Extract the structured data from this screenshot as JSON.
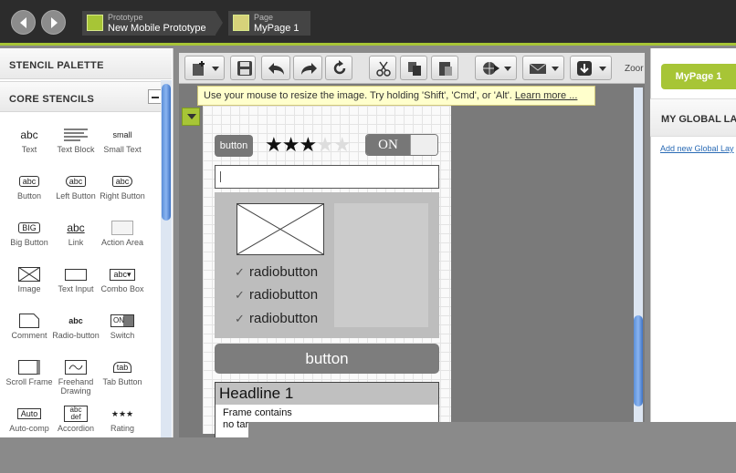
{
  "header": {
    "prototype_small": "Prototype",
    "prototype_name": "New Mobile Prototype",
    "page_small": "Page",
    "page_name": "MyPage 1"
  },
  "left_panel": {
    "title": "STENCIL PALETTE",
    "section": "CORE STENCILS",
    "stencils": [
      {
        "glyph": "abc",
        "label": "Text"
      },
      {
        "glyph": "",
        "label": "Text Block"
      },
      {
        "glyph": "small",
        "label": "Small Text"
      },
      {
        "glyph": "abc",
        "label": "Button"
      },
      {
        "glyph": "abc",
        "label": "Left Button"
      },
      {
        "glyph": "abc",
        "label": "Right Button"
      },
      {
        "glyph": "BIG",
        "label": "Big Button"
      },
      {
        "glyph": "abc",
        "label": "Link"
      },
      {
        "glyph": "",
        "label": "Action Area"
      },
      {
        "glyph": "",
        "label": "Image"
      },
      {
        "glyph": "",
        "label": "Text Input"
      },
      {
        "glyph": "abc▾",
        "label": "Combo Box"
      },
      {
        "glyph": "",
        "label": "Comment"
      },
      {
        "glyph": "abc",
        "label": "Radio-button"
      },
      {
        "glyph": "ON",
        "label": "Switch"
      },
      {
        "glyph": "",
        "label": "Scroll Frame"
      },
      {
        "glyph": "",
        "label": "Freehand Drawing"
      },
      {
        "glyph": "tab",
        "label": "Tab Button"
      },
      {
        "glyph": "Auto",
        "label": "Auto-comp"
      },
      {
        "glyph": "abc def",
        "label": "Accordion"
      },
      {
        "glyph": "★★★",
        "label": "Rating"
      }
    ]
  },
  "toolbar": {
    "zoom_label": "Zoor"
  },
  "tooltip": {
    "text": "Use your mouse to resize the image. Try holding 'Shift', 'Cmd', or 'Alt'.",
    "link": "Learn more ..."
  },
  "canvas": {
    "button_label": "button",
    "rating": 3,
    "rating_max": 5,
    "switch_label": "ON",
    "radio_items": [
      "radiobutton",
      "radiobutton",
      "radiobutton"
    ],
    "big_button_label": "button",
    "headline": "Headline 1",
    "frame_text_1": "Frame contains",
    "frame_text_2": "no targ"
  },
  "right_panel": {
    "page_tab": "MyPage 1",
    "global_head": "MY GLOBAL LAY",
    "global_link": "Add new Global Lay"
  },
  "colors": {
    "accent": "#a7c536",
    "topbar": "#2c2c2c"
  }
}
